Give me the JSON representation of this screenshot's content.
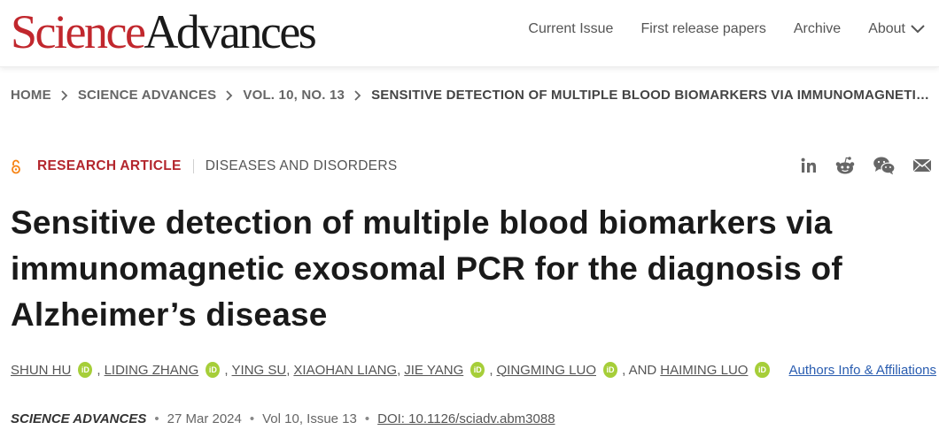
{
  "header": {
    "logo_part1": "Science",
    "logo_part2": "Advances",
    "nav": [
      "Current Issue",
      "First release papers",
      "Archive",
      "About"
    ]
  },
  "breadcrumb": [
    "HOME",
    "SCIENCE ADVANCES",
    "VOL. 10, NO. 13",
    "SENSITIVE DETECTION OF MULTIPLE BLOOD BIOMARKERS VIA IMMUNOMAGNETIC EXOSOMAL PCR FOR THE DIAGNOSIS OF ALZHEIMER’S DISEASE"
  ],
  "article": {
    "open_access_icon": "open-access-icon",
    "type": "RESEARCH ARTICLE",
    "topic": "DISEASES AND DISORDERS",
    "share_icons": [
      "linkedin-icon",
      "reddit-icon",
      "wechat-icon",
      "email-icon"
    ],
    "title": "Sensitive detection of multiple blood biomarkers via immunomagnetic exosomal PCR for the diagnosis of Alzheimer’s disease",
    "authors": [
      {
        "name": "SHUN HU",
        "orcid": true
      },
      {
        "name": "LIDING ZHANG",
        "orcid": true
      },
      {
        "name": "YING SU",
        "orcid": false
      },
      {
        "name": "XIAOHAN LIANG",
        "orcid": false
      },
      {
        "name": "JIE YANG",
        "orcid": true
      },
      {
        "name": "QINGMING LUO",
        "orcid": true
      },
      {
        "name": "HAIMING LUO",
        "orcid": true
      }
    ],
    "authors_and": ", AND",
    "orcid_text": "iD",
    "affiliations_link": "Authors Info & Affiliations",
    "journal": "SCIENCE ADVANCES",
    "date": "27 Mar 2024",
    "volume": "Vol 10, Issue 13",
    "doi": "DOI: 10.1126/sciadv.abm3088"
  },
  "colors": {
    "brand_red": "#c1272d",
    "article_type_red": "#b3262d",
    "orcid_green": "#a6ce39",
    "link_blue": "#2a5db0"
  }
}
